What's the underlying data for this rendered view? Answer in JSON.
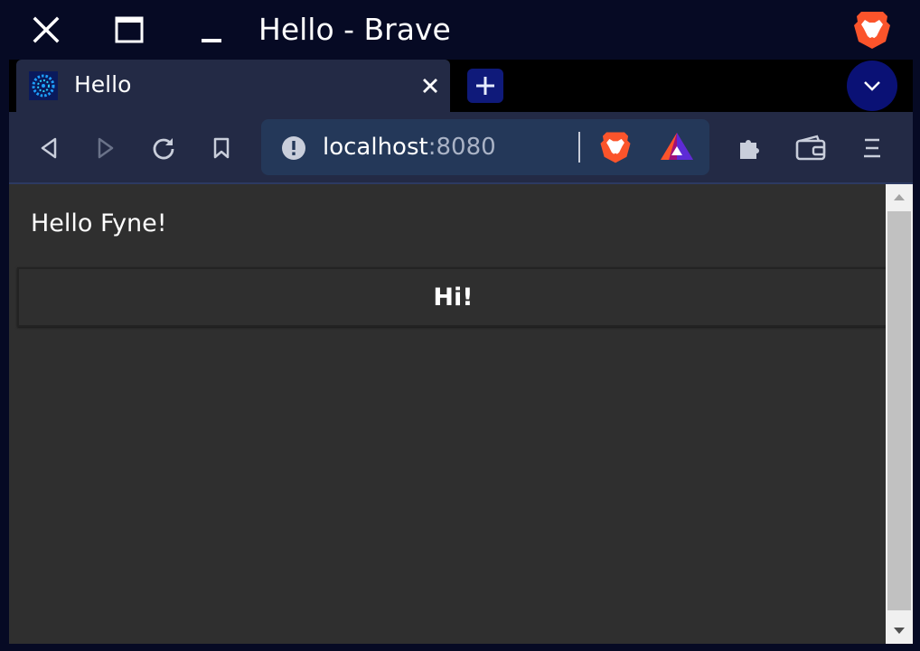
{
  "window": {
    "title": "Hello - Brave",
    "controls": [
      "close-icon",
      "maximize-icon",
      "minimize-icon"
    ],
    "brand_icon": "brave-lion-icon"
  },
  "tabs": [
    {
      "title": "Hello",
      "favicon": "fyne-favicon",
      "active": true
    }
  ],
  "toolbar": {
    "buttons": [
      "back-icon",
      "forward-icon",
      "reload-icon",
      "bookmark-icon",
      "extensions-icon",
      "wallet-icon",
      "menu-icon"
    ],
    "forward_disabled": true
  },
  "address_bar": {
    "host": "localhost",
    "port": ":8080",
    "security_icon": "info-icon",
    "shields_icon": "brave-shields-icon",
    "rewards_icon": "brave-rewards-icon"
  },
  "page": {
    "label": "Hello Fyne!",
    "button_label": "Hi!"
  },
  "colors": {
    "os_bar": "#060a24",
    "toolbar": "#232a45",
    "omnibox": "#243859",
    "content_bg": "#2f2f2f",
    "brave_orange": "#fb542b",
    "new_tab_blue": "#0f1a7a"
  }
}
